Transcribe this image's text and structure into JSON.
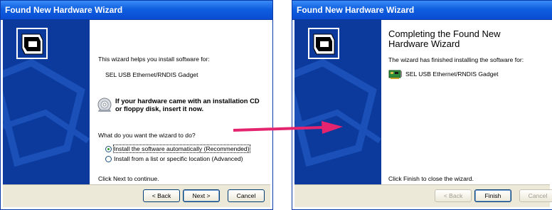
{
  "window1": {
    "title": "Found New Hardware Wizard",
    "intro": "This wizard helps you install software for:",
    "device": "SEL USB Ethernet/RNDIS Gadget",
    "cd_prompt_line1": "If your hardware came with an installation CD",
    "cd_prompt_line2": "or floppy disk, insert it now.",
    "question": "What do you want the wizard to do?",
    "option_auto": "Install the software automatically (Recommended)",
    "option_manual": "Install from a list or specific location (Advanced)",
    "continue_hint": "Click Next to continue.",
    "back_label": "< Back",
    "next_label": "Next >",
    "cancel_label": "Cancel"
  },
  "window2": {
    "title": "Found New Hardware Wizard",
    "heading_line1": "Completing the Found New",
    "heading_line2": "Hardware Wizard",
    "finished_text": "The wizard has finished installing the software for:",
    "device": "SEL USB Ethernet/RNDIS Gadget",
    "close_hint": "Click Finish to close the wizard.",
    "back_label": "< Back",
    "finish_label": "Finish",
    "cancel_label": "Cancel"
  },
  "colors": {
    "titlebar": "#0a4cd2",
    "side_panel": "#0b3a9c",
    "arrow": "#e4246f",
    "dialog_footer": "#ece9d8"
  }
}
